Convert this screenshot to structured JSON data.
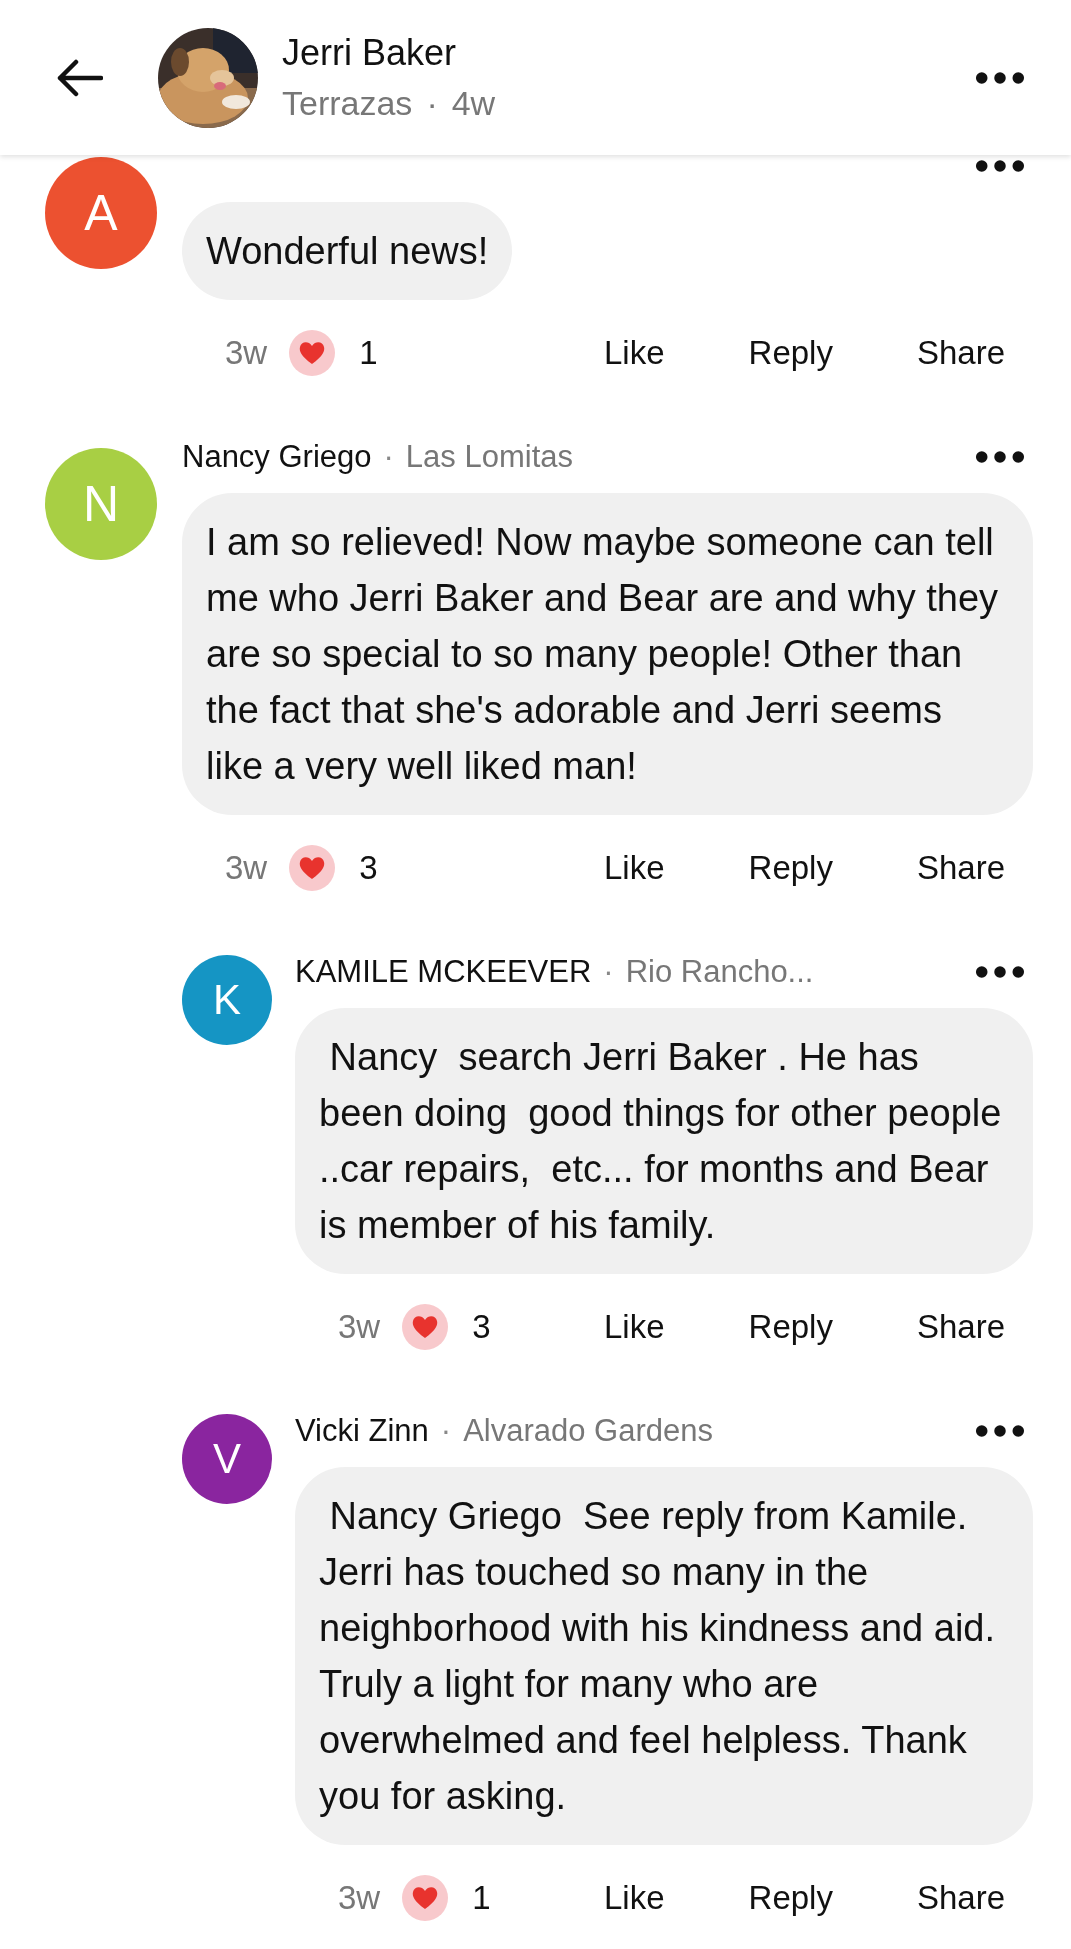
{
  "header": {
    "title": "Jerri Baker",
    "location": "Terrazas",
    "separator": "·",
    "time": "4w"
  },
  "comments": [
    {
      "initial": "A",
      "color": "#ec5130",
      "text": "Wonderful news!",
      "time": "3w",
      "reaction_count": "1",
      "actions": [
        "Like",
        "Reply",
        "Share"
      ]
    },
    {
      "author": "Nancy Griego",
      "separator": "·",
      "location": "Las Lomitas",
      "initial": "N",
      "color": "#a8cf44",
      "text": "I am so relieved! Now maybe someone can tell me who Jerri Baker and Bear are and why they are so special to so many people! Other than the fact that she's adorable and Jerri seems like a very well liked man!",
      "time": "3w",
      "reaction_count": "3",
      "actions": [
        "Like",
        "Reply",
        "Share"
      ],
      "children": [
        {
          "author": "KAMILE MCKEEVER",
          "separator": "·",
          "location": "Rio Rancho...",
          "initial": "K",
          "color": "#1595c4",
          "text": " Nancy  search Jerri Baker . He has been doing  good things for other people ..car repairs,  etc... for months and Bear is member of his family.",
          "time": "3w",
          "reaction_count": "3",
          "actions": [
            "Like",
            "Reply",
            "Share"
          ]
        },
        {
          "author": "Vicki Zinn",
          "separator": "·",
          "location": "Alvarado Gardens",
          "initial": "V",
          "color": "#8a259f",
          "text": " Nancy Griego  See reply from Kamile. Jerri has touched so many in the neighborhood with his kindness and aid. Truly a light for many who are overwhelmed and feel helpless. Thank you for asking.",
          "time": "3w",
          "reaction_count": "1",
          "actions": [
            "Like",
            "Reply",
            "Share"
          ]
        }
      ]
    }
  ]
}
